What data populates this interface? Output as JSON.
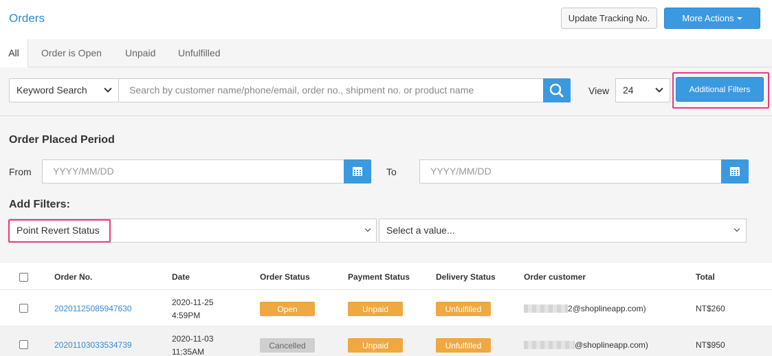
{
  "header": {
    "title": "Orders",
    "update_tracking_label": "Update Tracking No.",
    "more_actions_label": "More Actions"
  },
  "tabs": [
    {
      "label": "All",
      "active": true
    },
    {
      "label": "Order is Open",
      "active": false
    },
    {
      "label": "Unpaid",
      "active": false
    },
    {
      "label": "Unfulfilled",
      "active": false
    }
  ],
  "search": {
    "keyword_select": "Keyword Search",
    "placeholder": "Search by customer name/phone/email, order no., shipment no. or product name",
    "view_label": "View",
    "view_value": "24",
    "additional_filters_label": "Additional Filters"
  },
  "period": {
    "title": "Order Placed Period",
    "from_label": "From",
    "to_label": "To",
    "from_placeholder": "YYYY/MM/DD",
    "to_placeholder": "YYYY/MM/DD"
  },
  "add_filters": {
    "title": "Add Filters:",
    "field_value": "Point Revert Status",
    "value_placeholder": "Select a value..."
  },
  "table": {
    "columns": [
      "Order No.",
      "Date",
      "Order Status",
      "Payment Status",
      "Delivery Status",
      "Order customer",
      "Total"
    ],
    "rows": [
      {
        "order_no": "20201125085947630",
        "date": "2020-11-25",
        "time": "4:59PM",
        "order_status": "Open",
        "payment_status": "Unpaid",
        "delivery_status": "Unfulfilled",
        "customer": "2@shoplineapp.com)",
        "total": "NT$260"
      },
      {
        "order_no": "20201103033534739",
        "date": "2020-11-03",
        "time": "11:35AM",
        "order_status": "Cancelled",
        "payment_status": "Unpaid",
        "delivery_status": "Unfulfilled",
        "customer": "@shoplineapp.com)",
        "total": "NT$950"
      }
    ]
  },
  "colors": {
    "primary": "#3b99e0",
    "link": "#2e8bd6",
    "badge_orange": "#f0a840",
    "badge_gray": "#cfcfcf",
    "highlight": "#e63a7e"
  }
}
